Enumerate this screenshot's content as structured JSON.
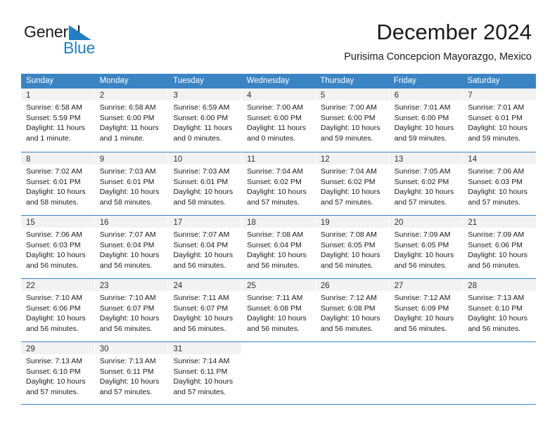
{
  "brand": {
    "word1": "General",
    "word2": "Blue",
    "logo_icon": "sail-triangle-icon",
    "accent_color": "#1f7fc4"
  },
  "header": {
    "title": "December 2024",
    "subtitle": "Purisima Concepcion Mayorazgo, Mexico"
  },
  "calendar": {
    "header_bg": "#3b84c4",
    "daynum_band_bg": "#f2f2f2",
    "weekdays": [
      "Sunday",
      "Monday",
      "Tuesday",
      "Wednesday",
      "Thursday",
      "Friday",
      "Saturday"
    ],
    "weeks": [
      [
        {
          "day": "1",
          "lines": [
            "Sunrise: 6:58 AM",
            "Sunset: 5:59 PM",
            "Daylight: 11 hours",
            "and 1 minute."
          ]
        },
        {
          "day": "2",
          "lines": [
            "Sunrise: 6:58 AM",
            "Sunset: 6:00 PM",
            "Daylight: 11 hours",
            "and 1 minute."
          ]
        },
        {
          "day": "3",
          "lines": [
            "Sunrise: 6:59 AM",
            "Sunset: 6:00 PM",
            "Daylight: 11 hours",
            "and 0 minutes."
          ]
        },
        {
          "day": "4",
          "lines": [
            "Sunrise: 7:00 AM",
            "Sunset: 6:00 PM",
            "Daylight: 11 hours",
            "and 0 minutes."
          ]
        },
        {
          "day": "5",
          "lines": [
            "Sunrise: 7:00 AM",
            "Sunset: 6:00 PM",
            "Daylight: 10 hours",
            "and 59 minutes."
          ]
        },
        {
          "day": "6",
          "lines": [
            "Sunrise: 7:01 AM",
            "Sunset: 6:00 PM",
            "Daylight: 10 hours",
            "and 59 minutes."
          ]
        },
        {
          "day": "7",
          "lines": [
            "Sunrise: 7:01 AM",
            "Sunset: 6:01 PM",
            "Daylight: 10 hours",
            "and 59 minutes."
          ]
        }
      ],
      [
        {
          "day": "8",
          "lines": [
            "Sunrise: 7:02 AM",
            "Sunset: 6:01 PM",
            "Daylight: 10 hours",
            "and 58 minutes."
          ]
        },
        {
          "day": "9",
          "lines": [
            "Sunrise: 7:03 AM",
            "Sunset: 6:01 PM",
            "Daylight: 10 hours",
            "and 58 minutes."
          ]
        },
        {
          "day": "10",
          "lines": [
            "Sunrise: 7:03 AM",
            "Sunset: 6:01 PM",
            "Daylight: 10 hours",
            "and 58 minutes."
          ]
        },
        {
          "day": "11",
          "lines": [
            "Sunrise: 7:04 AM",
            "Sunset: 6:02 PM",
            "Daylight: 10 hours",
            "and 57 minutes."
          ]
        },
        {
          "day": "12",
          "lines": [
            "Sunrise: 7:04 AM",
            "Sunset: 6:02 PM",
            "Daylight: 10 hours",
            "and 57 minutes."
          ]
        },
        {
          "day": "13",
          "lines": [
            "Sunrise: 7:05 AM",
            "Sunset: 6:02 PM",
            "Daylight: 10 hours",
            "and 57 minutes."
          ]
        },
        {
          "day": "14",
          "lines": [
            "Sunrise: 7:06 AM",
            "Sunset: 6:03 PM",
            "Daylight: 10 hours",
            "and 57 minutes."
          ]
        }
      ],
      [
        {
          "day": "15",
          "lines": [
            "Sunrise: 7:06 AM",
            "Sunset: 6:03 PM",
            "Daylight: 10 hours",
            "and 56 minutes."
          ]
        },
        {
          "day": "16",
          "lines": [
            "Sunrise: 7:07 AM",
            "Sunset: 6:04 PM",
            "Daylight: 10 hours",
            "and 56 minutes."
          ]
        },
        {
          "day": "17",
          "lines": [
            "Sunrise: 7:07 AM",
            "Sunset: 6:04 PM",
            "Daylight: 10 hours",
            "and 56 minutes."
          ]
        },
        {
          "day": "18",
          "lines": [
            "Sunrise: 7:08 AM",
            "Sunset: 6:04 PM",
            "Daylight: 10 hours",
            "and 56 minutes."
          ]
        },
        {
          "day": "19",
          "lines": [
            "Sunrise: 7:08 AM",
            "Sunset: 6:05 PM",
            "Daylight: 10 hours",
            "and 56 minutes."
          ]
        },
        {
          "day": "20",
          "lines": [
            "Sunrise: 7:09 AM",
            "Sunset: 6:05 PM",
            "Daylight: 10 hours",
            "and 56 minutes."
          ]
        },
        {
          "day": "21",
          "lines": [
            "Sunrise: 7:09 AM",
            "Sunset: 6:06 PM",
            "Daylight: 10 hours",
            "and 56 minutes."
          ]
        }
      ],
      [
        {
          "day": "22",
          "lines": [
            "Sunrise: 7:10 AM",
            "Sunset: 6:06 PM",
            "Daylight: 10 hours",
            "and 56 minutes."
          ]
        },
        {
          "day": "23",
          "lines": [
            "Sunrise: 7:10 AM",
            "Sunset: 6:07 PM",
            "Daylight: 10 hours",
            "and 56 minutes."
          ]
        },
        {
          "day": "24",
          "lines": [
            "Sunrise: 7:11 AM",
            "Sunset: 6:07 PM",
            "Daylight: 10 hours",
            "and 56 minutes."
          ]
        },
        {
          "day": "25",
          "lines": [
            "Sunrise: 7:11 AM",
            "Sunset: 6:08 PM",
            "Daylight: 10 hours",
            "and 56 minutes."
          ]
        },
        {
          "day": "26",
          "lines": [
            "Sunrise: 7:12 AM",
            "Sunset: 6:08 PM",
            "Daylight: 10 hours",
            "and 56 minutes."
          ]
        },
        {
          "day": "27",
          "lines": [
            "Sunrise: 7:12 AM",
            "Sunset: 6:09 PM",
            "Daylight: 10 hours",
            "and 56 minutes."
          ]
        },
        {
          "day": "28",
          "lines": [
            "Sunrise: 7:13 AM",
            "Sunset: 6:10 PM",
            "Daylight: 10 hours",
            "and 56 minutes."
          ]
        }
      ],
      [
        {
          "day": "29",
          "lines": [
            "Sunrise: 7:13 AM",
            "Sunset: 6:10 PM",
            "Daylight: 10 hours",
            "and 57 minutes."
          ]
        },
        {
          "day": "30",
          "lines": [
            "Sunrise: 7:13 AM",
            "Sunset: 6:11 PM",
            "Daylight: 10 hours",
            "and 57 minutes."
          ]
        },
        {
          "day": "31",
          "lines": [
            "Sunrise: 7:14 AM",
            "Sunset: 6:11 PM",
            "Daylight: 10 hours",
            "and 57 minutes."
          ]
        },
        {
          "day": "",
          "lines": []
        },
        {
          "day": "",
          "lines": []
        },
        {
          "day": "",
          "lines": []
        },
        {
          "day": "",
          "lines": []
        }
      ]
    ]
  }
}
